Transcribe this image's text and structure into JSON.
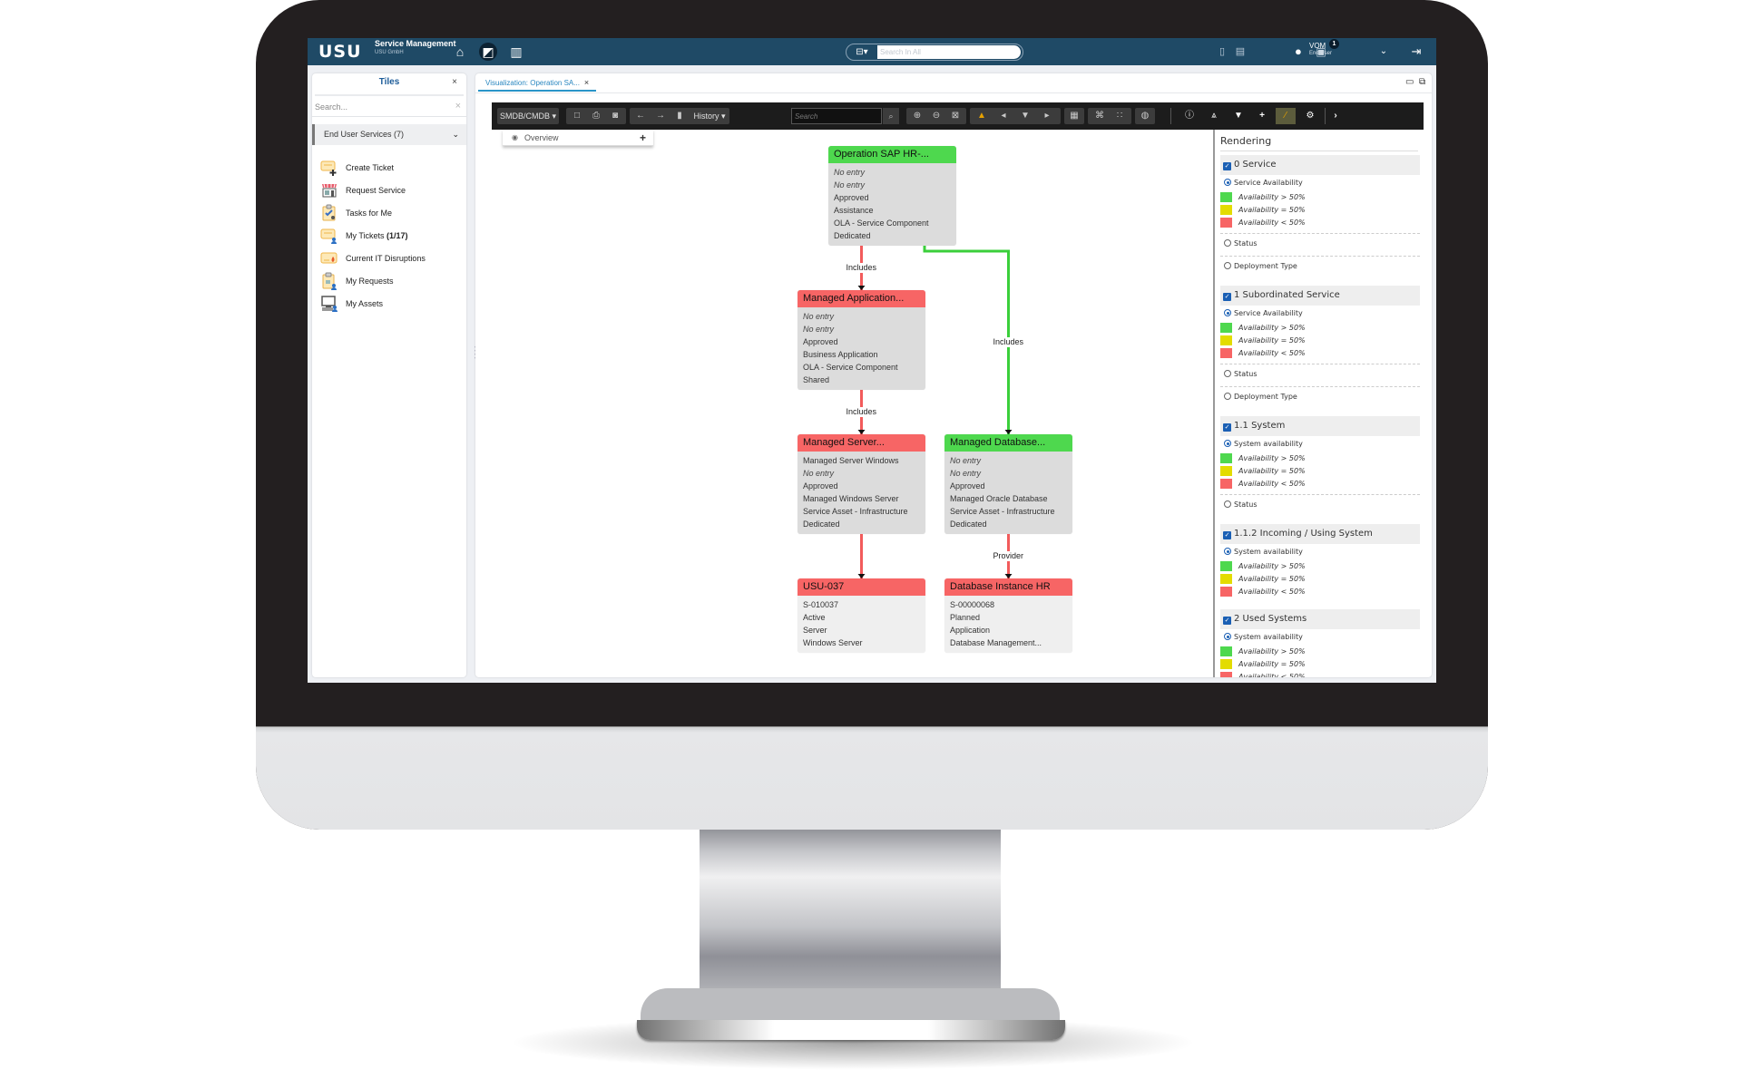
{
  "app": {
    "logo": "USU",
    "product": "Service Management",
    "company": "USU GmbH",
    "nav": [
      {
        "name": "home-icon",
        "glyph": "⌂"
      },
      {
        "name": "visualization-icon",
        "glyph": "◩"
      },
      {
        "name": "reports-icon",
        "glyph": "▥"
      }
    ],
    "search": {
      "placeholder": "Search In All",
      "scope_icon": "⊟▾"
    },
    "notifications": {
      "count": "1"
    },
    "user": {
      "name": "VOM",
      "role": "End User"
    }
  },
  "tiles": {
    "title": "Tiles",
    "close": "×",
    "search_placeholder": "Search...",
    "clear": "×",
    "group": {
      "label": "End User Services (7)",
      "chevron": "⌄"
    },
    "items": [
      {
        "label": "Create Ticket",
        "bold_suffix": ""
      },
      {
        "label": "Request Service",
        "bold_suffix": ""
      },
      {
        "label": "Tasks for Me",
        "bold_suffix": ""
      },
      {
        "label": "My Tickets",
        "bold_suffix": "(1/17)"
      },
      {
        "label": "Current IT Disruptions",
        "bold_suffix": ""
      },
      {
        "label": "My Requests",
        "bold_suffix": ""
      },
      {
        "label": "My Assets",
        "bold_suffix": ""
      }
    ]
  },
  "main": {
    "tab": {
      "label": "Visualization: Operation SA...",
      "close": "×"
    },
    "toolbar": {
      "datasource": "SMDB/CMDB ▾",
      "history": "History ▾",
      "search_placeholder": "Search"
    },
    "overview": {
      "label": "Overview",
      "add": "+"
    }
  },
  "diagram": {
    "colors": {
      "green": "#4ed84e",
      "red": "#f76565",
      "yellow": "#e3dc00",
      "edge_green": "#3bcf3b",
      "edge_red": "#f25b5b"
    },
    "nodes": [
      {
        "id": "n1",
        "title": "Operation SAP HR-...",
        "status": "green",
        "lines": [
          {
            "t": "No entry",
            "i": true
          },
          {
            "t": "No entry",
            "i": true
          },
          {
            "t": "Approved",
            "i": false
          },
          {
            "t": "Assistance",
            "i": false
          },
          {
            "t": "OLA - Service Component",
            "i": false
          },
          {
            "t": "Dedicated",
            "i": false
          }
        ]
      },
      {
        "id": "n2",
        "title": "Managed Application...",
        "status": "red",
        "lines": [
          {
            "t": "No entry",
            "i": true
          },
          {
            "t": "No entry",
            "i": true
          },
          {
            "t": "Approved",
            "i": false
          },
          {
            "t": "Business Application",
            "i": false
          },
          {
            "t": "OLA - Service Component",
            "i": false
          },
          {
            "t": "Shared",
            "i": false
          }
        ]
      },
      {
        "id": "n3",
        "title": "Managed Server...",
        "status": "red",
        "lines": [
          {
            "t": "Managed Server Windows",
            "i": false
          },
          {
            "t": "No entry",
            "i": true
          },
          {
            "t": "Approved",
            "i": false
          },
          {
            "t": "Managed Windows Server",
            "i": false
          },
          {
            "t": "Service Asset - Infrastructure",
            "i": false
          },
          {
            "t": "Dedicated",
            "i": false
          }
        ]
      },
      {
        "id": "n4",
        "title": "Managed Database...",
        "status": "green",
        "lines": [
          {
            "t": "No entry",
            "i": true
          },
          {
            "t": "No entry",
            "i": true
          },
          {
            "t": "Approved",
            "i": false
          },
          {
            "t": "Managed Oracle Database",
            "i": false
          },
          {
            "t": "Service Asset - Infrastructure",
            "i": false
          },
          {
            "t": "Dedicated",
            "i": false
          }
        ]
      },
      {
        "id": "n5",
        "title": "USU-037",
        "status": "red",
        "lines": [
          {
            "t": "S-010037",
            "i": false
          },
          {
            "t": "Active",
            "i": false
          },
          {
            "t": "Server",
            "i": false
          },
          {
            "t": "Windows Server",
            "i": false
          }
        ]
      },
      {
        "id": "n6",
        "title": "Database Instance HR",
        "status": "red",
        "lines": [
          {
            "t": "S-00000068",
            "i": false
          },
          {
            "t": "Planned",
            "i": false
          },
          {
            "t": "Application",
            "i": false
          },
          {
            "t": "Database Management...",
            "i": false
          }
        ]
      }
    ],
    "edges": [
      {
        "from": "n1",
        "to": "n2",
        "label": "Includes",
        "status": "red"
      },
      {
        "from": "n1",
        "to": "n4",
        "label": "Includes",
        "status": "green"
      },
      {
        "from": "n2",
        "to": "n3",
        "label": "Includes",
        "status": "red"
      },
      {
        "from": "n3",
        "to": "n5",
        "label": "",
        "status": "red"
      },
      {
        "from": "n4",
        "to": "n6",
        "label": "Provider",
        "status": "red"
      }
    ]
  },
  "rendering": {
    "title": "Rendering",
    "legend": [
      "Availability > 50%",
      "Availability = 50%",
      "Availability < 50%"
    ],
    "sections": [
      {
        "label": "0 Service",
        "checked": true,
        "options": [
          {
            "label": "Service Availability",
            "selected": true,
            "legend": true
          },
          {
            "label": "Status",
            "selected": false,
            "legend": false
          },
          {
            "label": "Deployment Type",
            "selected": false,
            "legend": false
          }
        ]
      },
      {
        "label": "1 Subordinated Service",
        "checked": true,
        "options": [
          {
            "label": "Service Availability",
            "selected": true,
            "legend": true
          },
          {
            "label": "Status",
            "selected": false,
            "legend": false
          },
          {
            "label": "Deployment Type",
            "selected": false,
            "legend": false
          }
        ]
      },
      {
        "label": "1.1 System",
        "checked": true,
        "options": [
          {
            "label": "System availability",
            "selected": true,
            "legend": true
          },
          {
            "label": "Status",
            "selected": false,
            "legend": false
          }
        ]
      },
      {
        "label": "1.1.2 Incoming / Using System",
        "checked": true,
        "options": [
          {
            "label": "System availability",
            "selected": true,
            "legend": true
          }
        ]
      },
      {
        "label": "2 Used Systems",
        "checked": true,
        "options": [
          {
            "label": "System availability",
            "selected": true,
            "legend": true
          }
        ]
      }
    ]
  }
}
